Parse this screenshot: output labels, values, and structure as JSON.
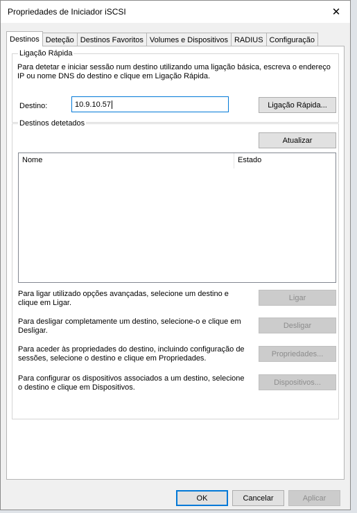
{
  "window": {
    "title": "Propriedades de Iniciador iSCSI"
  },
  "tabs": [
    "Destinos",
    "Deteção",
    "Destinos Favoritos",
    "Volumes e Dispositivos",
    "RADIUS",
    "Configuração"
  ],
  "quick_connect": {
    "legend": "Ligação Rápida",
    "description": "Para detetar e iniciar sessão num destino utilizando uma ligação básica, escreva o endereço IP ou nome DNS do destino e clique em Ligação Rápida.",
    "target_label": "Destino:",
    "target_value": "10.9.10.57",
    "button": "Ligação Rápida..."
  },
  "discovered": {
    "legend": "Destinos detetados",
    "refresh_button": "Atualizar",
    "columns": [
      "Nome",
      "Estado"
    ],
    "rows": []
  },
  "actions": [
    {
      "text": "Para ligar utilizado opções avançadas, selecione um destino e clique em Ligar.",
      "button": "Ligar"
    },
    {
      "text": "Para desligar completamente um destino, selecione-o e clique em Desligar.",
      "button": "Desligar"
    },
    {
      "text": "Para aceder às propriedades do destino, incluindo configuração de sessões, selecione o destino e clique em Propriedades.",
      "button": "Propriedades..."
    },
    {
      "text": "Para configurar os dispositivos associados a um destino, selecione o destino e clique em Dispositivos.",
      "button": "Dispositivos..."
    }
  ],
  "footer": {
    "ok": "OK",
    "cancel": "Cancelar",
    "apply": "Aplicar"
  },
  "icons": {
    "close": "close-icon"
  }
}
